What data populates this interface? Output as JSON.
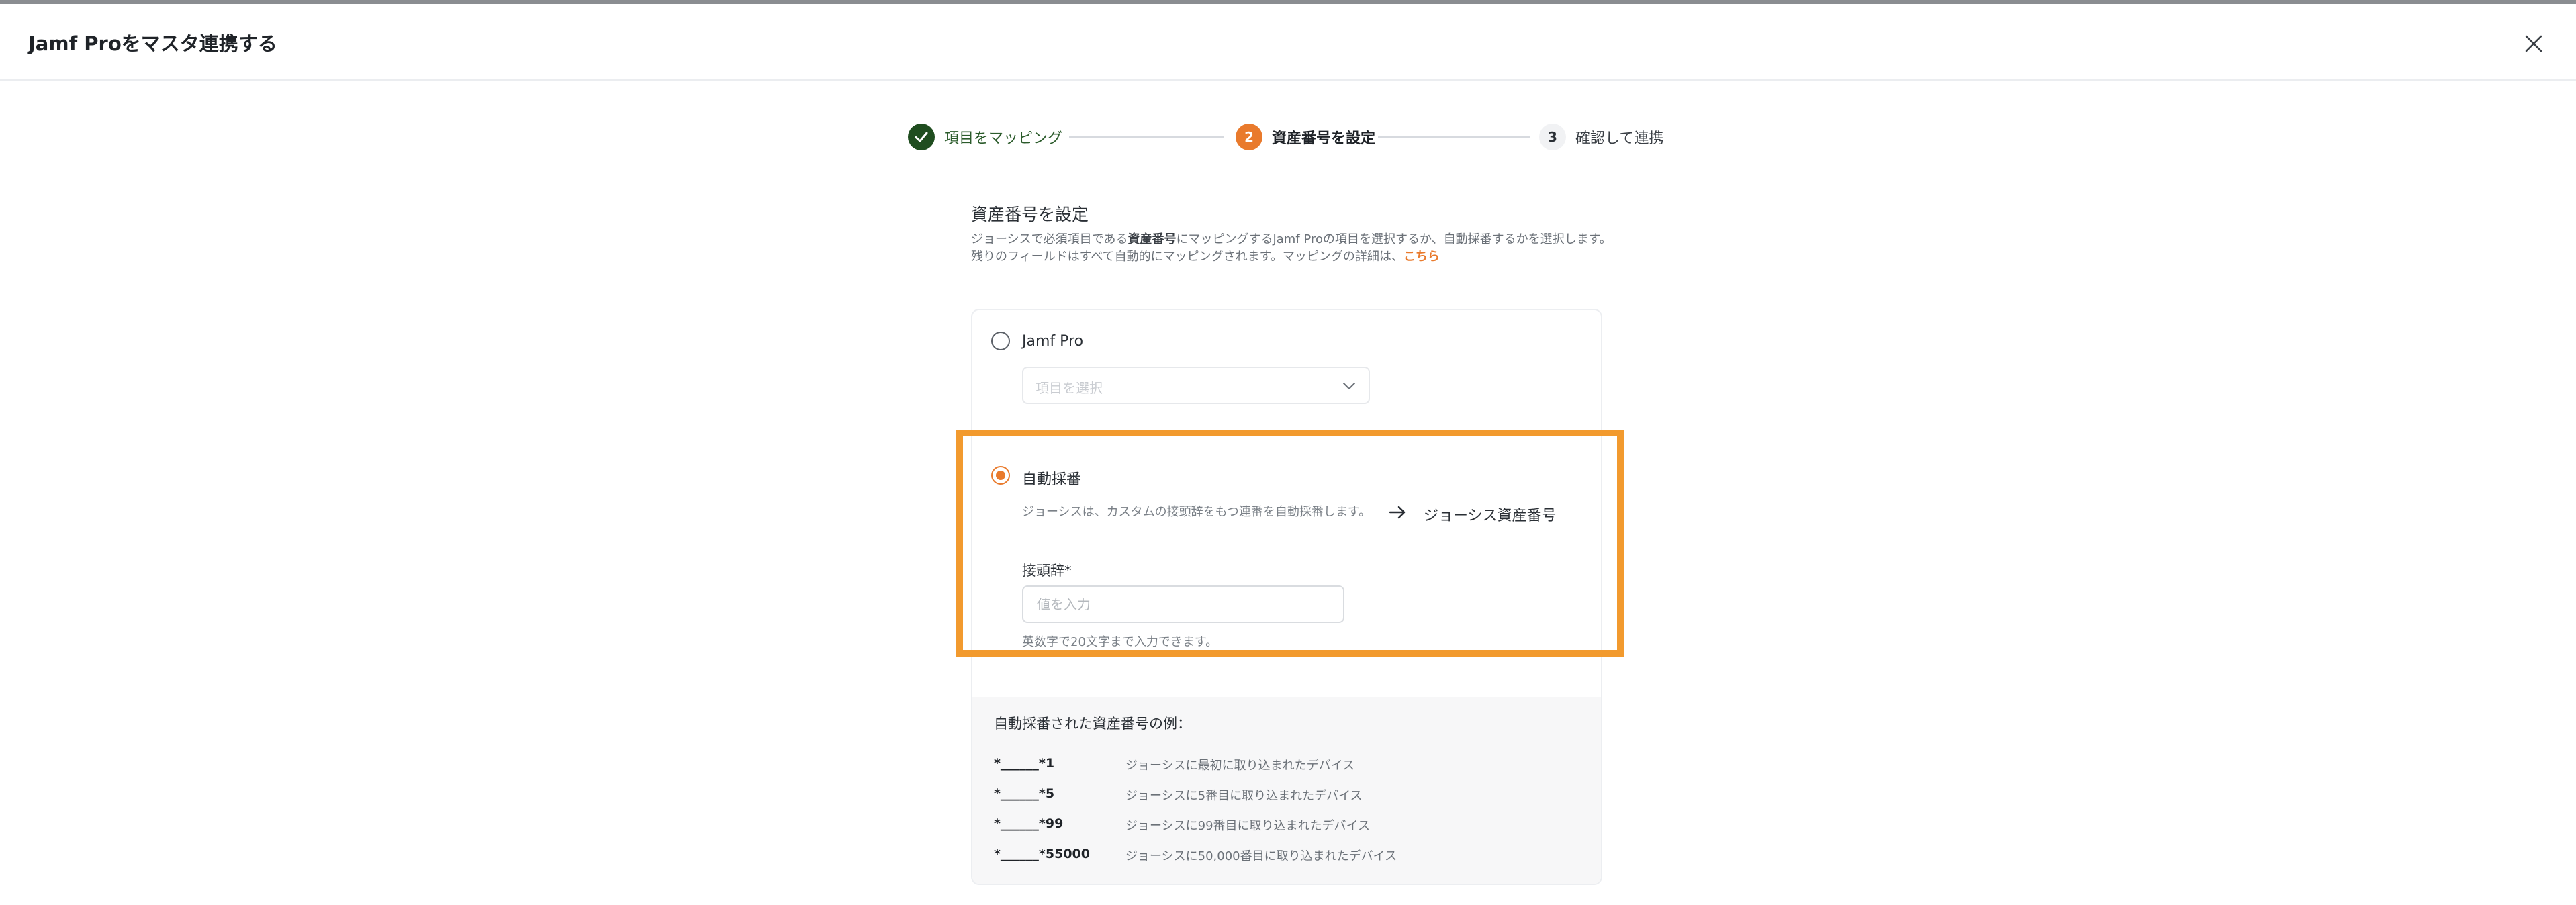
{
  "modal": {
    "title": "Jamf Proをマスタ連携する"
  },
  "stepper": {
    "steps": [
      {
        "number": "1",
        "label": "項目をマッピング",
        "state": "completed"
      },
      {
        "number": "2",
        "label": "資産番号を設定",
        "state": "current"
      },
      {
        "number": "3",
        "label": "確認して連携",
        "state": "upcoming"
      }
    ]
  },
  "section": {
    "title": "資産番号を設定",
    "desc_part1": "ジョーシスで必須項目である",
    "desc_bold": "資産番号",
    "desc_part2": "にマッピングするJamf Proの項目を選択するか、自動採番するかを選択します。",
    "desc_line2": "残りのフィールドはすべて自動的にマッピングされます。マッピングの詳細は、",
    "desc_link": "こちら"
  },
  "options": {
    "jamf": {
      "label": "Jamf Pro",
      "selected": false,
      "select_placeholder": "項目を選択"
    },
    "auto": {
      "label": "自動採番",
      "selected": true,
      "description": "ジョーシスは、カスタムの接頭辞をもつ連番を自動採番します。",
      "target": "ジョーシス資産番号",
      "prefix_label": "接頭辞*",
      "prefix_placeholder": "値を入力",
      "prefix_value": "",
      "prefix_hint": "英数字で20文字まで入力できます。"
    }
  },
  "examples": {
    "title": "自動採番された資産番号の例：",
    "rows": [
      {
        "code": "*______*1",
        "desc": "ジョーシスに最初に取り込まれたデバイス"
      },
      {
        "code": "*______*5",
        "desc": "ジョーシスに5番目に取り込まれたデバイス"
      },
      {
        "code": "*______*99",
        "desc": "ジョーシスに99番目に取り込まれたデバイス"
      },
      {
        "code": "*______*55000",
        "desc": "ジョーシスに50,000番目に取り込まれたデバイス"
      }
    ]
  },
  "colors": {
    "accent": "#e97a2c",
    "completed": "#1f4d1f",
    "highlight": "#f29a2e"
  }
}
